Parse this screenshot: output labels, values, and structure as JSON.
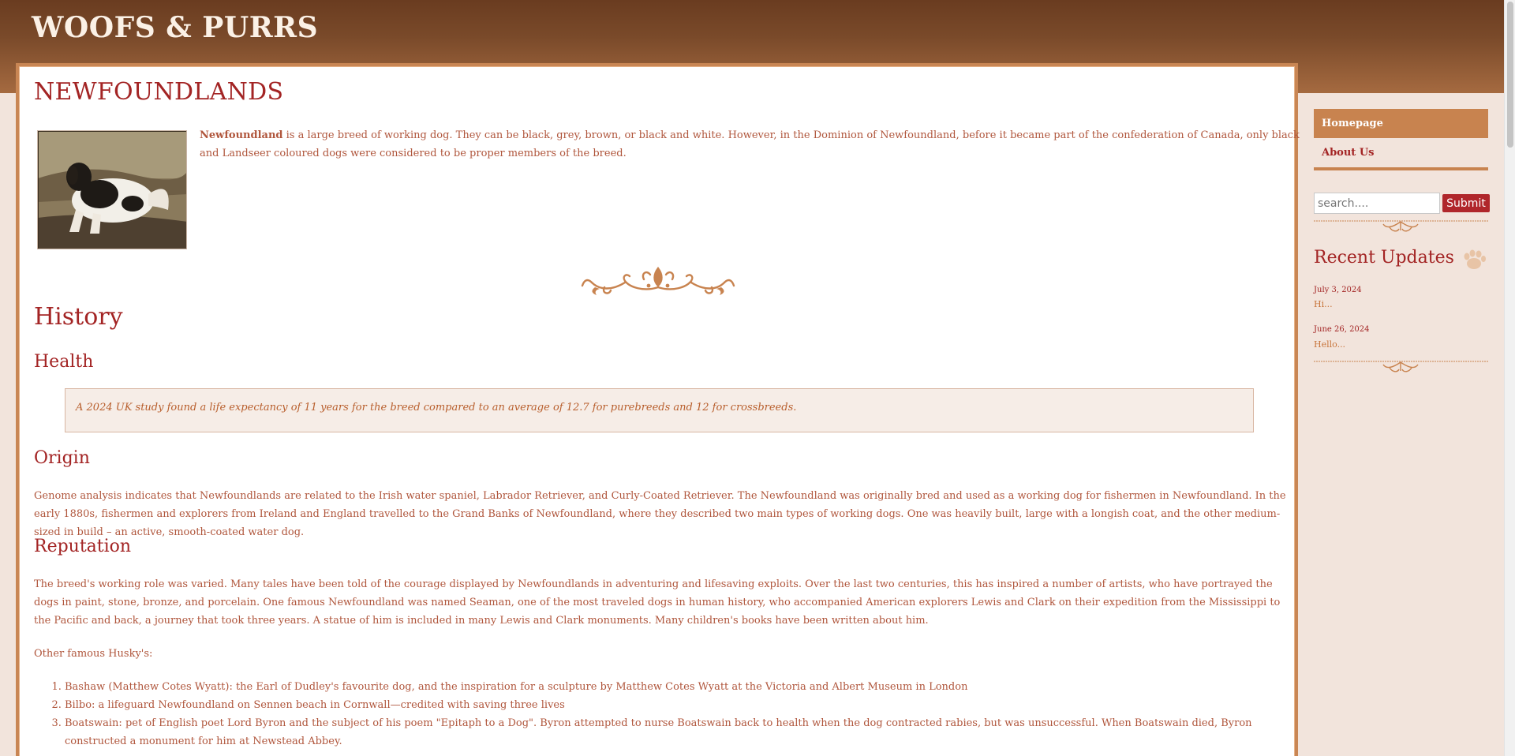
{
  "site": {
    "title": "WOOFS & PURRS"
  },
  "page": {
    "title": "NEWFOUNDLANDS",
    "intro_bold": "Newfoundland",
    "intro_rest": " is a large breed of working dog. They can be black, grey, brown, or black and white. However, in the Dominion of Newfoundland, before it became part of the confederation of Canada, only black and Landseer coloured dogs were considered to be proper members of the breed.",
    "history_heading": "History",
    "health_heading": "Health",
    "health_quote": "A 2024 UK study found a life expectancy of 11 years for the breed compared to an average of 12.7 for purebreeds and 12 for crossbreeds.",
    "origin_heading": "Origin",
    "origin_text": "Genome analysis indicates that Newfoundlands are related to the Irish water spaniel, Labrador Retriever, and Curly-Coated Retriever. The Newfoundland was originally bred and used as a working dog for fishermen in Newfoundland. In the early 1880s, fishermen and explorers from Ireland and England travelled to the Grand Banks of Newfoundland, where they described two main types of working dogs. One was heavily built, large with a longish coat, and the other medium-sized in build – an active, smooth-coated water dog.",
    "reputation_heading": "Reputation",
    "reputation_text": "The breed's working role was varied. Many tales have been told of the courage displayed by Newfoundlands in adventuring and lifesaving exploits. Over the last two centuries, this has inspired a number of artists, who have portrayed the dogs in paint, stone, bronze, and porcelain. One famous Newfoundland was named Seaman, one of the most traveled dogs in human history, who accompanied American explorers Lewis and Clark on their expedition from the Mississippi to the Pacific and back, a journey that took three years. A statue of him is included in many Lewis and Clark monuments. Many children's books have been written about him.",
    "famous_intro": "Other famous Husky's:",
    "famous_list": [
      "Bashaw (Matthew Cotes Wyatt): the Earl of Dudley's favourite dog, and the inspiration for a sculpture by Matthew Cotes Wyatt at the Victoria and Albert Museum in London",
      "Bilbo: a lifeguard Newfoundland on Sennen beach in Cornwall—credited with saving three lives",
      "Boatswain: pet of English poet Lord Byron and the subject of his poem \"Epitaph to a Dog\". Byron attempted to nurse Boatswain back to health when the dog contracted rabies, but was unsuccessful. When Boatswain died, Byron constructed a monument for him at Newstead Abbey."
    ]
  },
  "sidebar": {
    "nav": [
      {
        "label": "Homepage",
        "active": true
      },
      {
        "label": "About Us",
        "active": false
      }
    ],
    "search": {
      "placeholder": "search....",
      "submit_label": "Submit"
    },
    "recent_title": "Recent Updates",
    "updates": [
      {
        "date": "July 3, 2024",
        "text": "Hi..."
      },
      {
        "date": "June 26, 2024",
        "text": "Hello..."
      }
    ]
  },
  "colors": {
    "brand_red": "#a32424",
    "accent_copper": "#c8834f",
    "body_text": "#b0563c",
    "page_bg": "#f2e4dc"
  }
}
